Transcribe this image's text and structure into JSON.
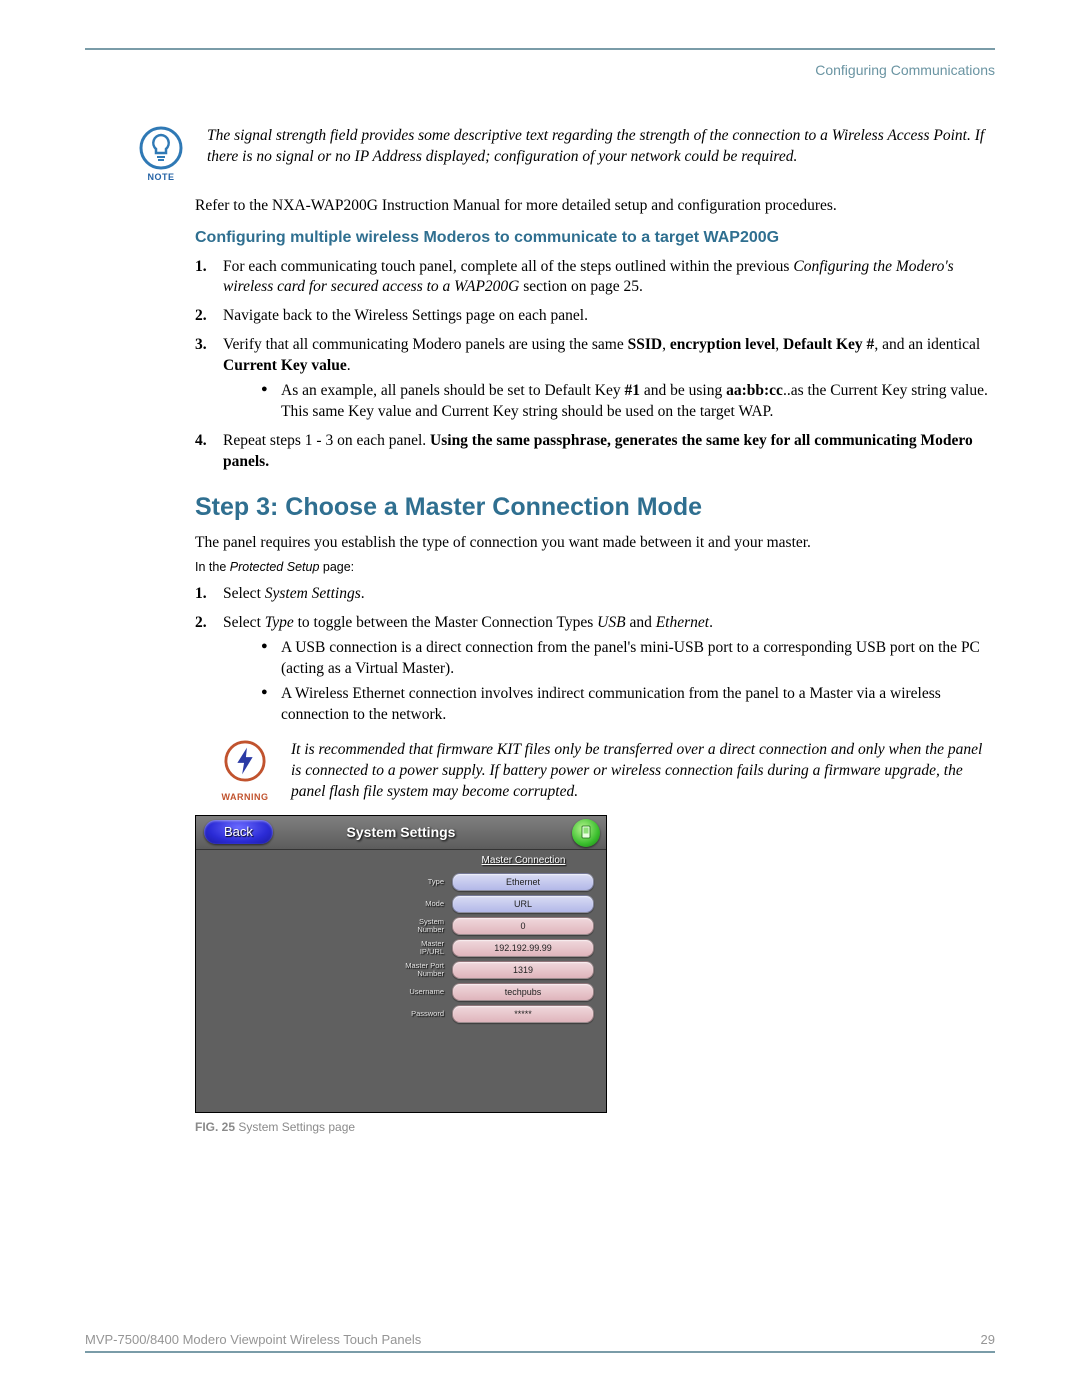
{
  "header": {
    "section": "Configuring Communications"
  },
  "note": {
    "label": "NOTE",
    "text": "The signal strength field provides some descriptive text regarding the strength of the connection to a Wireless Access Point. If there is no signal or no IP Address displayed; configuration of your network could be required."
  },
  "refer": "Refer to the NXA-WAP200G Instruction Manual for more detailed setup and configuration procedures.",
  "subheading": "Configuring multiple wireless Moderos to communicate to a target WAP200G",
  "list1": {
    "i1a": "For each communicating touch panel, complete all of the steps outlined within the previous ",
    "i1b": "Configuring the Modero's wireless card for secured access to a WAP200G",
    "i1c": " section on page 25.",
    "i2": "Navigate back to the Wireless Settings page on each panel.",
    "i3a": "Verify that all communicating Modero panels are using the same ",
    "i3_ssid": "SSID",
    "i3b": ", ",
    "i3_enc": "encryption level",
    "i3c": ", ",
    "i3_def": "Default Key #",
    "i3d": ", and an identical ",
    "i3_ckv": "Current Key value",
    "i3e": ".",
    "i3_sub_a": "As an example, all panels should be set to Default Key ",
    "i3_sub_num": "#1",
    "i3_sub_b": " and be using ",
    "i3_sub_key": "aa:bb:cc",
    "i3_sub_c": "..as the Current Key string value. This same Key value and Current Key string should be used on the target WAP.",
    "i4a": "Repeat steps 1 - 3 on each panel. ",
    "i4b": "Using the same passphrase, generates the same key for all communicating Modero panels."
  },
  "step3": {
    "title": "Step 3: Choose a Master Connection Mode",
    "intro": "The panel requires you establish the type of connection you want made between it and your master.",
    "inthe_a": "In the ",
    "inthe_b": "Protected Setup",
    "inthe_c": " page:",
    "o1a": "Select ",
    "o1b": "System Settings",
    "o1c": ".",
    "o2a": "Select ",
    "o2b": "Type",
    "o2c": " to toggle between the Master Connection Types ",
    "o2d": "USB",
    "o2e": " and ",
    "o2f": "Ethernet",
    "o2g": ".",
    "b1": "A USB connection is a direct connection from the panel's mini-USB port to a corresponding USB port on the PC (acting as a Virtual Master).",
    "b2": "A Wireless Ethernet connection involves indirect communication from the panel to a Master via a wireless connection to the network."
  },
  "warning": {
    "label": "WARNING",
    "text": "It is recommended that firmware KIT files only be transferred over a direct connection and only when the panel is connected to a power supply. If battery power or wireless connection fails during a firmware upgrade, the panel flash file system may become corrupted."
  },
  "screenshot": {
    "back": "Back",
    "title": "System Settings",
    "section": "Master Connection",
    "rows": [
      {
        "label": "Type",
        "value": "Ethernet",
        "cls": "pill-blue"
      },
      {
        "label": "Mode",
        "value": "URL",
        "cls": "pill-blue"
      },
      {
        "label": "System Number",
        "value": "0",
        "cls": "pill-pink"
      },
      {
        "label": "Master IP/URL",
        "value": "192.192.99.99",
        "cls": "pill-pink"
      },
      {
        "label": "Master Port Number",
        "value": "1319",
        "cls": "pill-pink"
      },
      {
        "label": "Username",
        "value": "techpubs",
        "cls": "pill-pink"
      },
      {
        "label": "Password",
        "value": "*****",
        "cls": "pill-pink"
      }
    ]
  },
  "figure": {
    "prefix": "FIG. 25",
    "caption": "  System Settings page"
  },
  "footer": {
    "left": "MVP-7500/8400 Modero Viewpoint Wireless Touch Panels",
    "right": "29"
  }
}
